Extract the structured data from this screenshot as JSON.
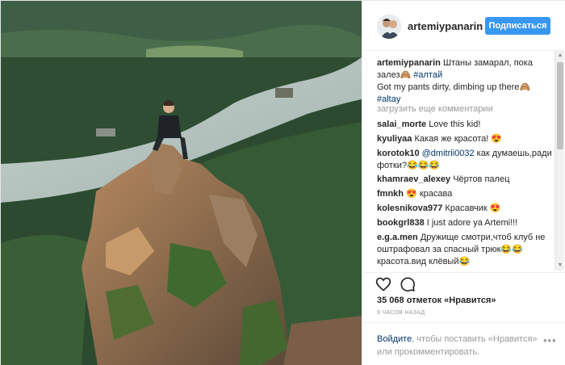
{
  "post": {
    "image_alt": "Man sitting on top of a rock pinnacle above a river valley",
    "username": "artemiypanarin",
    "follow_label": "Подписаться",
    "caption": {
      "username": "artemiypanarin",
      "text_ru": "Штаны замарал, пока залез🙈",
      "hashtag1": "#алтай",
      "text_en": "Got my pants dirty, dimbing up there🙈",
      "hashtag2": "#altay"
    },
    "load_more": "загрузить еще комментарии",
    "comments": [
      {
        "username": "salai_morte",
        "text": "Love this kid!"
      },
      {
        "username": "kyuliyaa",
        "text": "Какая же красота! 😍"
      },
      {
        "username": "korotok10",
        "mention": "@dmitrii0032",
        "text": " как думаешь,ради фотки?😂😂😂"
      },
      {
        "username": "khamraev_alexey",
        "text": "Чёртов палец"
      },
      {
        "username": "fmnkh",
        "text": "😍 красава"
      },
      {
        "username": "kolesnikova977",
        "text": "Красавчик 😍"
      },
      {
        "username": "bookgrl838",
        "text": "I just adore ya Artemi!!!"
      },
      {
        "username": "e.g.a.men",
        "text": "Дружище смотри,чтоб клуб не оштрафовал за спасный трюк😂😂 красота.вид клёвый😂"
      }
    ],
    "actions": {
      "like_icon": "heart-icon",
      "comment_icon": "comment-bubble-icon"
    },
    "likes": "35 068 отметок «Нравится»",
    "timestamp": "9 ЧАСОВ НАЗАД",
    "login": {
      "link": "Войдите",
      "text": ", чтобы поставить «Нравится» или прокомментировать."
    },
    "more_icon": "more-dots-icon"
  }
}
